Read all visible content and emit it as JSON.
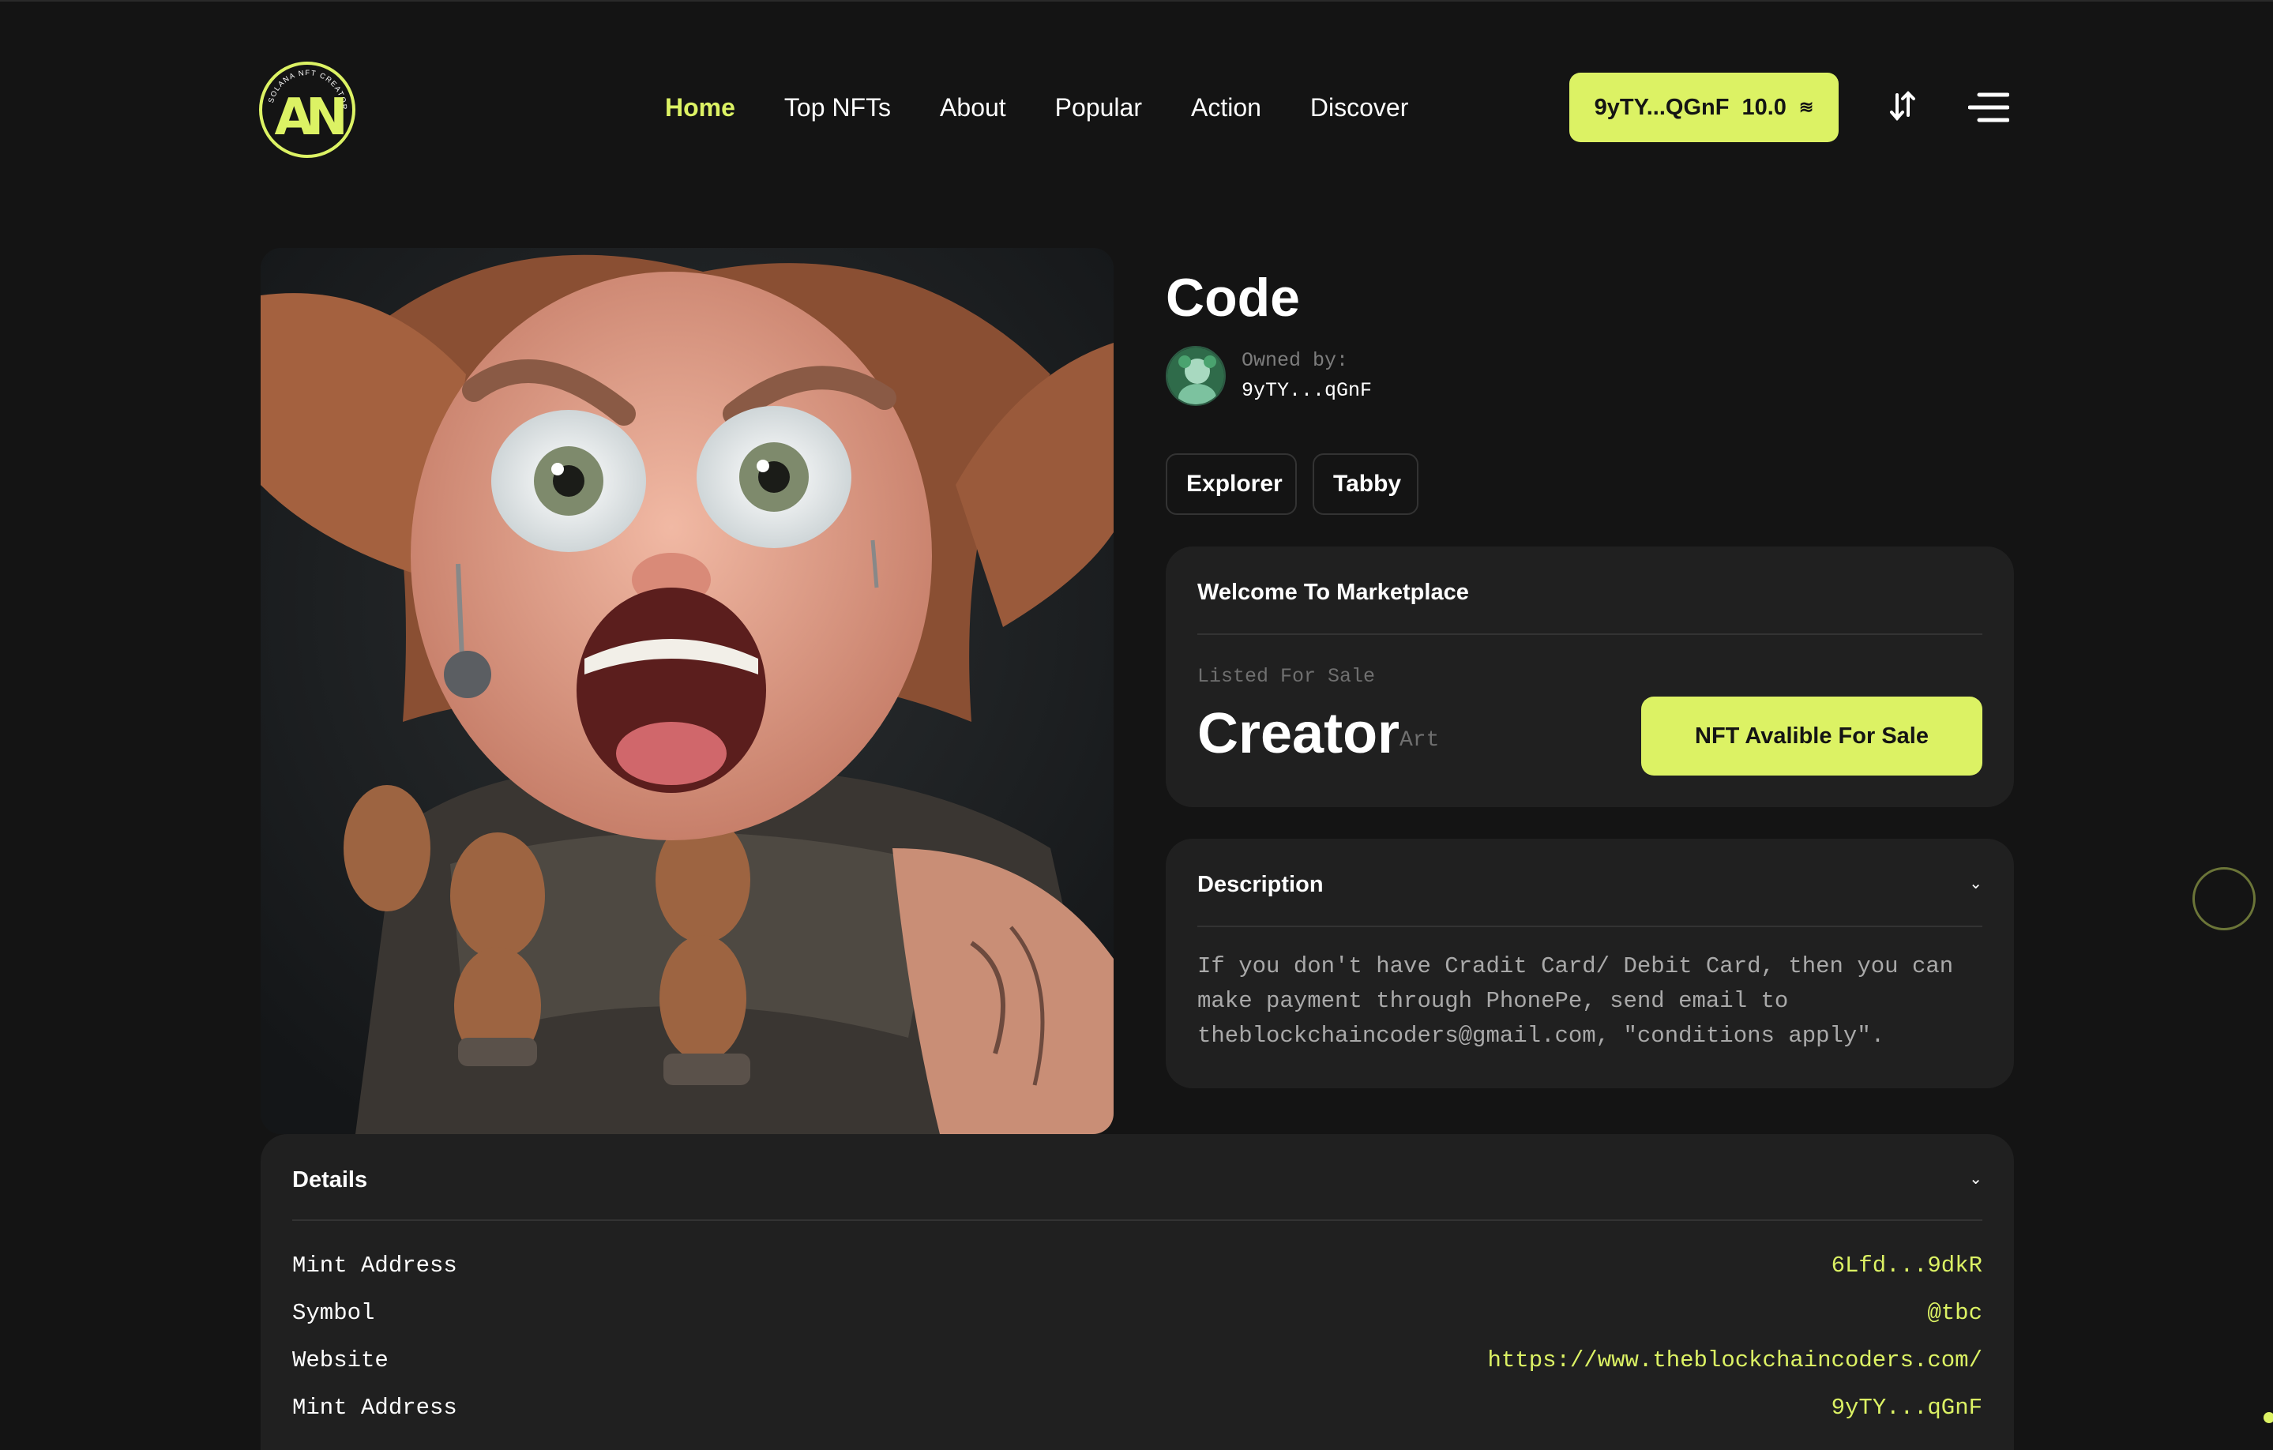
{
  "header": {
    "logo_ring_text": "SOLANA NFT CREATOR",
    "logo_mark": "AN",
    "nav": [
      "Home",
      "Top NFTs",
      "About",
      "Popular",
      "Action",
      "Discover"
    ],
    "active_nav": "Home",
    "wallet_address": "9yTY...QGnF",
    "wallet_balance": "10.0",
    "wallet_currency_icon": "solana-icon",
    "icons": [
      "sort-icon",
      "menu-icon"
    ]
  },
  "nft": {
    "title": "Code",
    "owned_label": "Owned by:",
    "owner": "9yTY...qGnF",
    "tags": [
      "Explorer",
      "Tabby"
    ]
  },
  "marketplace": {
    "heading": "Welcome To Marketplace",
    "listed_label": "Listed For Sale",
    "creator": "Creator",
    "creator_sub": "Art",
    "sale_button": "NFT Avalible For Sale"
  },
  "description": {
    "heading": "Description",
    "text": "If you don't have Cradit Card/ Debit Card, then you can make payment through PhonePe, send email to theblockchaincoders@gmail.com, \"conditions apply\"."
  },
  "details": {
    "heading": "Details",
    "rows": [
      {
        "label": "Mint Address",
        "value": "6Lfd...9dkR"
      },
      {
        "label": "Symbol",
        "value": "@tbc"
      },
      {
        "label": "Website",
        "value": "https://www.theblockchaincoders.com/"
      },
      {
        "label": "Mint Address",
        "value": "9yTY...qGnF"
      }
    ]
  },
  "colors": {
    "accent": "#dcf264",
    "background": "#141414",
    "card": "#202020"
  }
}
